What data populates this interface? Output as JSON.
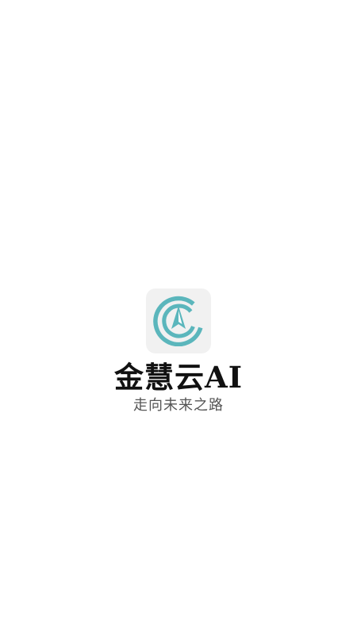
{
  "app": {
    "name": "金慧云AI",
    "slogan": "走向未来之路",
    "logo_icon": "compass-ring-icon",
    "brand_color": "#5bb6bc",
    "tile_color": "#f1f1f1"
  }
}
